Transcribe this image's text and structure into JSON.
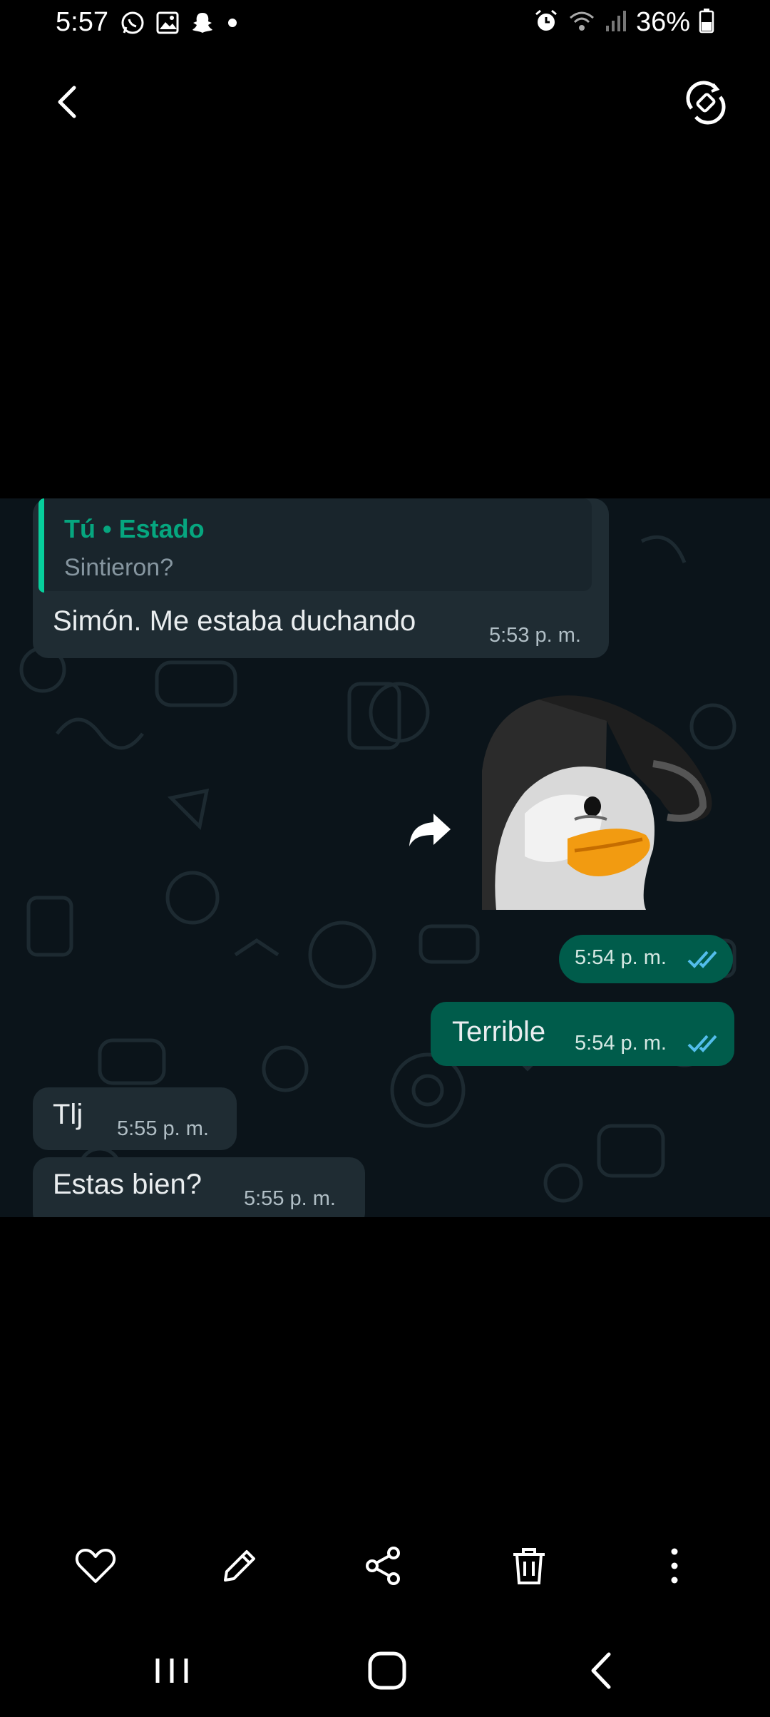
{
  "status_bar": {
    "time": "5:57",
    "battery": "36%",
    "icons": [
      "whatsapp-icon",
      "gallery-icon",
      "snapchat-icon",
      "dot-icon",
      "alarm-icon",
      "wifi-icon",
      "signal-icon",
      "battery-icon"
    ]
  },
  "top_bar": {
    "back_icon": "chevron-left-icon",
    "rotate_icon": "rotate-icon"
  },
  "chat": {
    "messages": [
      {
        "direction": "incoming",
        "reply": {
          "author": "Tú • Estado",
          "text": "Sintieron?"
        },
        "text": "Simón. Me estaba duchando",
        "time": "5:53 p. m."
      },
      {
        "direction": "outgoing",
        "type": "sticker",
        "sticker": "penguin-salute",
        "time": "5:54 p. m.",
        "status": "read"
      },
      {
        "direction": "outgoing",
        "text": "Terrible",
        "time": "5:54 p. m.",
        "status": "read"
      },
      {
        "direction": "incoming",
        "text": "Tlj",
        "time": "5:55 p. m."
      },
      {
        "direction": "incoming",
        "text": "Estas bien?",
        "time": "5:55 p. m."
      }
    ]
  },
  "bottom_toolbar": [
    "heart-icon",
    "edit-icon",
    "share-icon",
    "trash-icon",
    "more-icon"
  ],
  "nav_bar": [
    "recents-icon",
    "home-icon",
    "back-icon"
  ],
  "colors": {
    "incoming_bubble": "#1f2c33",
    "outgoing_bubble": "#005c4b",
    "chat_background": "#0b141a",
    "read_ticks": "#53bdeb"
  }
}
